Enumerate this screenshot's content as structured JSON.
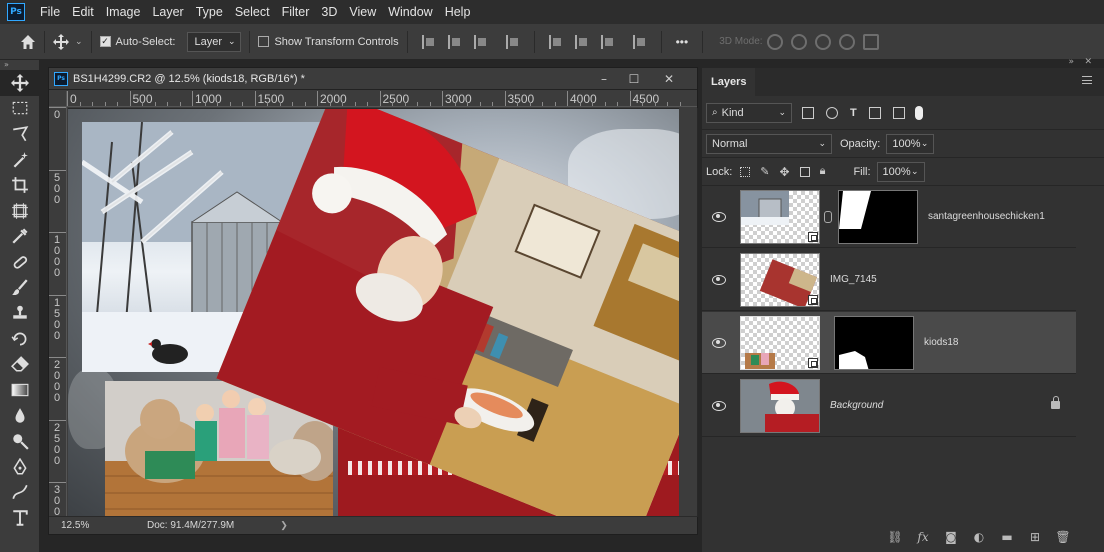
{
  "menu": {
    "logo": "Ps",
    "items": [
      "File",
      "Edit",
      "Image",
      "Layer",
      "Type",
      "Select",
      "Filter",
      "3D",
      "View",
      "Window",
      "Help"
    ]
  },
  "options": {
    "auto_select_label": "Auto-Select:",
    "auto_select_checked": true,
    "auto_select_target": "Layer",
    "show_transform_label": "Show Transform Controls",
    "show_transform_checked": false,
    "more": "•••",
    "mode_3d": "3D Mode:"
  },
  "document": {
    "title": "BS1H4299.CR2 @ 12.5% (kiods18, RGB/16*) *",
    "ruler_top": [
      "0",
      "500",
      "1000",
      "1500",
      "2000",
      "2500",
      "3000",
      "3500",
      "4000",
      "4500"
    ],
    "ruler_left": [
      "0",
      "500",
      "1000",
      "1500",
      "2000",
      "2500",
      "3000"
    ],
    "zoom": "12.5%",
    "doc_size": "Doc: 91.4M/277.9M",
    "status_arrow": "❯"
  },
  "layers_panel": {
    "tab": "Layers",
    "filter_kind": "Kind",
    "blend_mode": "Normal",
    "opacity_label": "Opacity:",
    "opacity_value": "100%",
    "lock_label": "Lock:",
    "fill_label": "Fill:",
    "fill_value": "100%",
    "layers": [
      {
        "name": "santagreenhousechicken1",
        "visible": true,
        "has_mask": true,
        "selected": false,
        "locked": false
      },
      {
        "name": "IMG_7145",
        "visible": true,
        "has_mask": false,
        "selected": false,
        "locked": false
      },
      {
        "name": "kiods18",
        "visible": true,
        "has_mask": true,
        "selected": true,
        "locked": false
      },
      {
        "name": "Background",
        "visible": true,
        "has_mask": false,
        "selected": false,
        "locked": true
      }
    ]
  },
  "colors": {
    "brand": "#31a8ff",
    "panel_bg": "#323232",
    "selected_layer": "#4a4a4a",
    "santa_red": "#b51d23"
  },
  "icons": {
    "home": "home-icon",
    "move": "move-icon",
    "filter": "filter-image-icon",
    "lock": "lock-icon"
  }
}
